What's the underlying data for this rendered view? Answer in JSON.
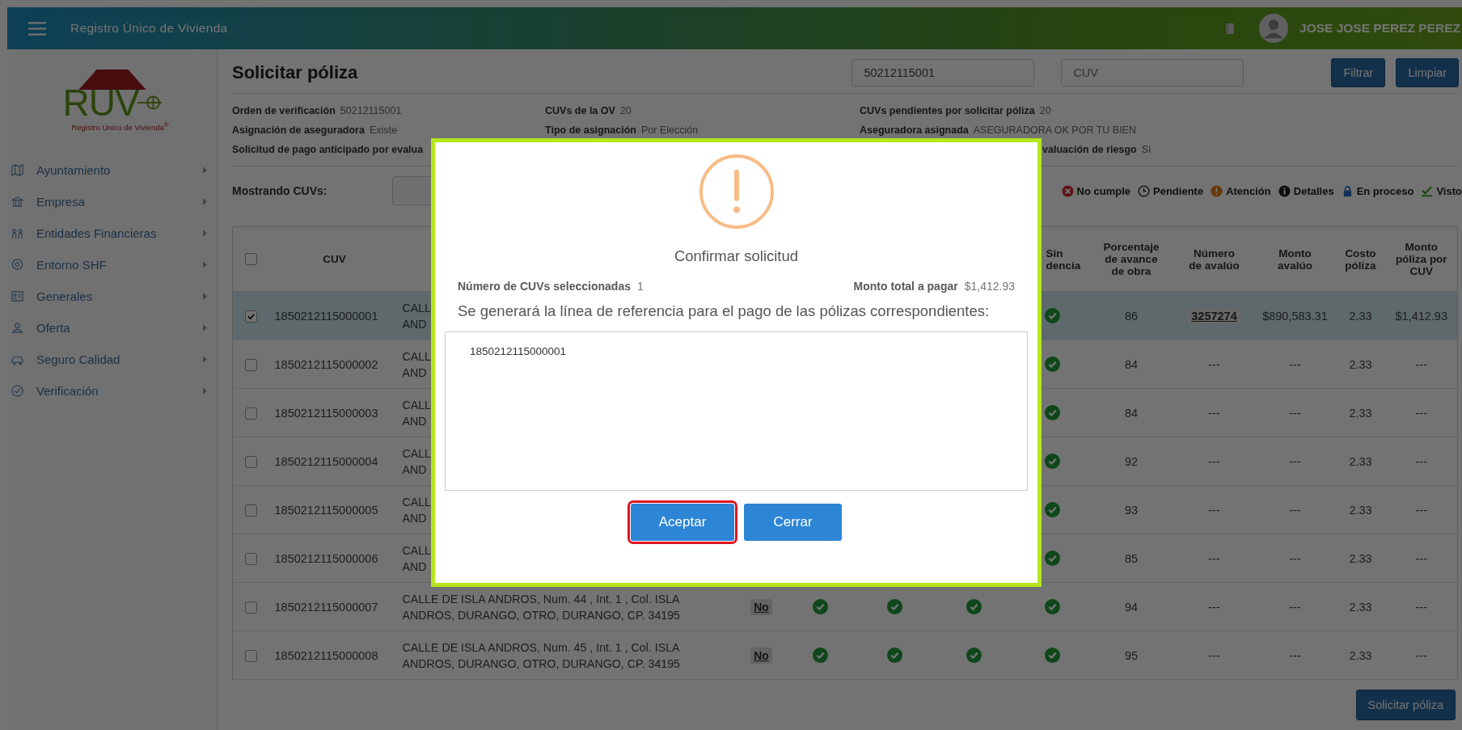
{
  "header": {
    "title": "Registro Único de Vivienda",
    "user": "JOSE JOSE PEREZ PEREZ"
  },
  "logo": {
    "letters": "RUV",
    "caption": "Registro Único de Vivienda$^{®}$"
  },
  "sidebar": {
    "items": [
      {
        "label": "Ayuntamiento",
        "kind": "map"
      },
      {
        "label": "Empresa",
        "kind": "bank"
      },
      {
        "label": "Entidades Financieras",
        "kind": "people"
      },
      {
        "label": "Entorno SHF",
        "kind": "pin"
      },
      {
        "label": "Generales",
        "kind": "card"
      },
      {
        "label": "Oferta",
        "kind": "user"
      },
      {
        "label": "Seguro Calidad",
        "kind": "car"
      },
      {
        "label": "Verificación",
        "kind": "check"
      }
    ]
  },
  "page": {
    "title": "Solicitar póliza",
    "search_value": "50212115001",
    "cuv_placeholder": "CUV",
    "buttons": [
      "Filtrar",
      "Limpiar"
    ]
  },
  "info": [
    [
      {
        "label": "Orden de verificación",
        "value": "50212115001"
      },
      {
        "label": "CUVs de la OV",
        "value": "20"
      },
      {
        "label": "CUVs pendientes por solicitar póliza",
        "value": "20"
      }
    ],
    [
      {
        "label": "Asignación de aseguradora",
        "value": "Existe"
      },
      {
        "label": "Tipo de asignación",
        "value": "Por Elección"
      },
      {
        "label": "Aseguradora asignada",
        "value": "ASEGURADORA OK POR TU BIEN"
      }
    ],
    [
      {
        "label": "Solicitud de pago anticipado por evalua"
      },
      {
        "kind": "covered"
      },
      {
        "label": "valuación de riesgo",
        "value": "Sí",
        "kind": "partial"
      }
    ]
  ],
  "filter": {
    "label": "Mostrando CUVs:"
  },
  "legend": [
    {
      "label": "No cumple",
      "kind": "fail"
    },
    {
      "label": "Pendiente",
      "kind": "clock"
    },
    {
      "label": "Atención",
      "kind": "warning"
    },
    {
      "label": "Detalles",
      "kind": "info"
    },
    {
      "label": "En proceso",
      "kind": "lock"
    },
    {
      "label": "Visto",
      "kind": "seen"
    }
  ],
  "table": {
    "select_all": {
      "checked": false
    },
    "columns": [
      {
        "kind": "text",
        "label": "CUV"
      },
      {
        "kind": "partial",
        "label": "Sin dencia"
      },
      {
        "kind": "text",
        "label": "Porcentaje de avance de obra"
      },
      {
        "kind": "text",
        "label": "Número de avalúo"
      },
      {
        "kind": "text",
        "label": "Monto avalúo"
      },
      {
        "kind": "text",
        "label": "Costo póliza"
      },
      {
        "kind": "text",
        "label": "Monto póliza por CUV"
      }
    ],
    "rows": [
      {
        "selected": true,
        "cuv": "1850212115000001",
        "address": "CALL\nAND",
        "sin": true,
        "avance": "86",
        "avaluo": "3257274",
        "avaluo_link": true,
        "monto_avaluo": "$890,583.31",
        "costo": "2.33",
        "monto_poliza": "$1,412.93"
      },
      {
        "selected": false,
        "cuv": "1850212115000002",
        "address": "CALL\nAND",
        "sin": true,
        "avance": "84",
        "avaluo": "---",
        "avaluo_link": false,
        "monto_avaluo": "---",
        "costo": "2.33",
        "monto_poliza": "---"
      },
      {
        "selected": false,
        "cuv": "1850212115000003",
        "address": "CALL\nAND",
        "sin": true,
        "avance": "84",
        "avaluo": "---",
        "avaluo_link": false,
        "monto_avaluo": "---",
        "costo": "2.33",
        "monto_poliza": "---"
      },
      {
        "selected": false,
        "cuv": "1850212115000004",
        "address": "CALL\nAND",
        "sin": true,
        "avance": "92",
        "avaluo": "---",
        "avaluo_link": false,
        "monto_avaluo": "---",
        "costo": "2.33",
        "monto_poliza": "---"
      },
      {
        "selected": false,
        "cuv": "1850212115000005",
        "address": "CALL\nAND",
        "sin": true,
        "avance": "93",
        "avaluo": "---",
        "avaluo_link": false,
        "monto_avaluo": "---",
        "costo": "2.33",
        "monto_poliza": "---"
      },
      {
        "selected": false,
        "cuv": "1850212115000006",
        "address": "CALL\nAND",
        "sin": true,
        "avance": "85",
        "avaluo": "---",
        "avaluo_link": false,
        "monto_avaluo": "---",
        "costo": "2.33",
        "monto_poliza": "---"
      },
      {
        "selected": false,
        "cuv": "1850212115000007",
        "address": "CALLE DE ISLA ANDROS, Num. 44 , Int. 1 , Col. ISLA\nANDROS, DURANGO, OTRO, DURANGO, CP. 34195",
        "badge": "No",
        "checks": [
          true,
          true,
          true
        ],
        "sin": true,
        "avance": "94",
        "avaluo": "---",
        "avaluo_link": false,
        "monto_avaluo": "---",
        "costo": "2.33",
        "monto_poliza": "---"
      },
      {
        "selected": false,
        "cuv": "1850212115000008",
        "address": "CALLE DE ISLA ANDROS, Num. 45 , Int. 1 , Col. ISLA\nANDROS, DURANGO, OTRO, DURANGO, CP. 34195",
        "badge": "No",
        "checks": [
          true,
          true,
          true
        ],
        "sin": true,
        "avance": "95",
        "avaluo": "---",
        "avaluo_link": false,
        "monto_avaluo": "---",
        "costo": "2.33",
        "monto_poliza": "---"
      }
    ]
  },
  "footer": {
    "button": "Solicitar póliza"
  },
  "modal": {
    "title": "Confirmar solicitud",
    "count_label": "Número de CUVs seleccionadas",
    "count": "1",
    "total_label": "Monto total a pagar",
    "total": "$1,412.93",
    "message": "Se generará la línea de referencia para el pago de las pólizas correspondientes:",
    "list": [
      "1850212115000001"
    ],
    "buttons": [
      {
        "label": "Aceptar",
        "focused": true
      },
      {
        "label": "Cerrar",
        "focused": false
      }
    ]
  }
}
